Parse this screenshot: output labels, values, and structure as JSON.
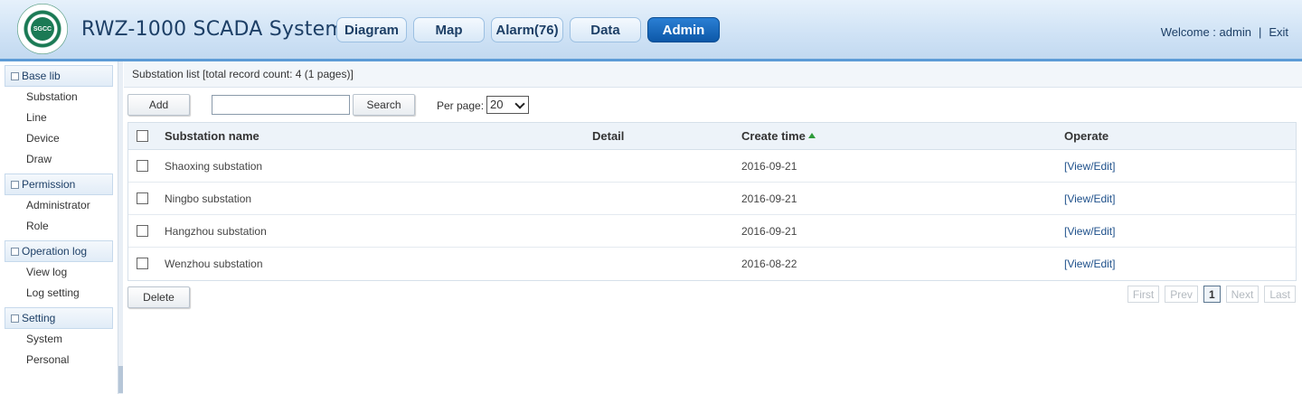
{
  "header": {
    "title": "RWZ-1000 SCADA System",
    "logo_text": "SGCC",
    "nav": [
      {
        "label": "Diagram"
      },
      {
        "label": "Map"
      },
      {
        "label": "Alarm(76)"
      },
      {
        "label": "Data"
      },
      {
        "label": "Admin"
      }
    ],
    "welcome": "Welcome : admin",
    "separator": "|",
    "exit": "Exit"
  },
  "sidebar": {
    "groups": [
      {
        "label": "Base lib",
        "items": [
          "Substation",
          "Line",
          "Device",
          "Draw"
        ]
      },
      {
        "label": "Permission",
        "items": [
          "Administrator",
          "Role"
        ]
      },
      {
        "label": "Operation log",
        "items": [
          "View log",
          "Log setting"
        ]
      },
      {
        "label": "Setting",
        "items": [
          "System",
          "Personal"
        ]
      }
    ]
  },
  "main": {
    "list_title": "Substation list [total record count: 4 (1 pages)]",
    "add_label": "Add",
    "search_value": "",
    "search_label": "Search",
    "per_page_label": "Per page:",
    "per_page_value": "20",
    "delete_label": "Delete",
    "columns": {
      "name": "Substation name",
      "detail": "Detail",
      "time": "Create time",
      "operate": "Operate"
    },
    "rows": [
      {
        "name": "Shaoxing substation",
        "detail": "",
        "time": "2016-09-21",
        "op": "[View/Edit]"
      },
      {
        "name": "Ningbo substation",
        "detail": "",
        "time": "2016-09-21",
        "op": "[View/Edit]"
      },
      {
        "name": "Hangzhou substation",
        "detail": "",
        "time": "2016-09-21",
        "op": "[View/Edit]"
      },
      {
        "name": "Wenzhou substation",
        "detail": "",
        "time": "2016-08-22",
        "op": "[View/Edit]"
      }
    ],
    "pager": {
      "first": "First",
      "prev": "Prev",
      "current": "1",
      "next": "Next",
      "last": "Last"
    }
  },
  "colors": {
    "accent": "#0d58a8",
    "header_bg": "#cfe2f5",
    "sort_arrow": "#2e9b3a"
  }
}
